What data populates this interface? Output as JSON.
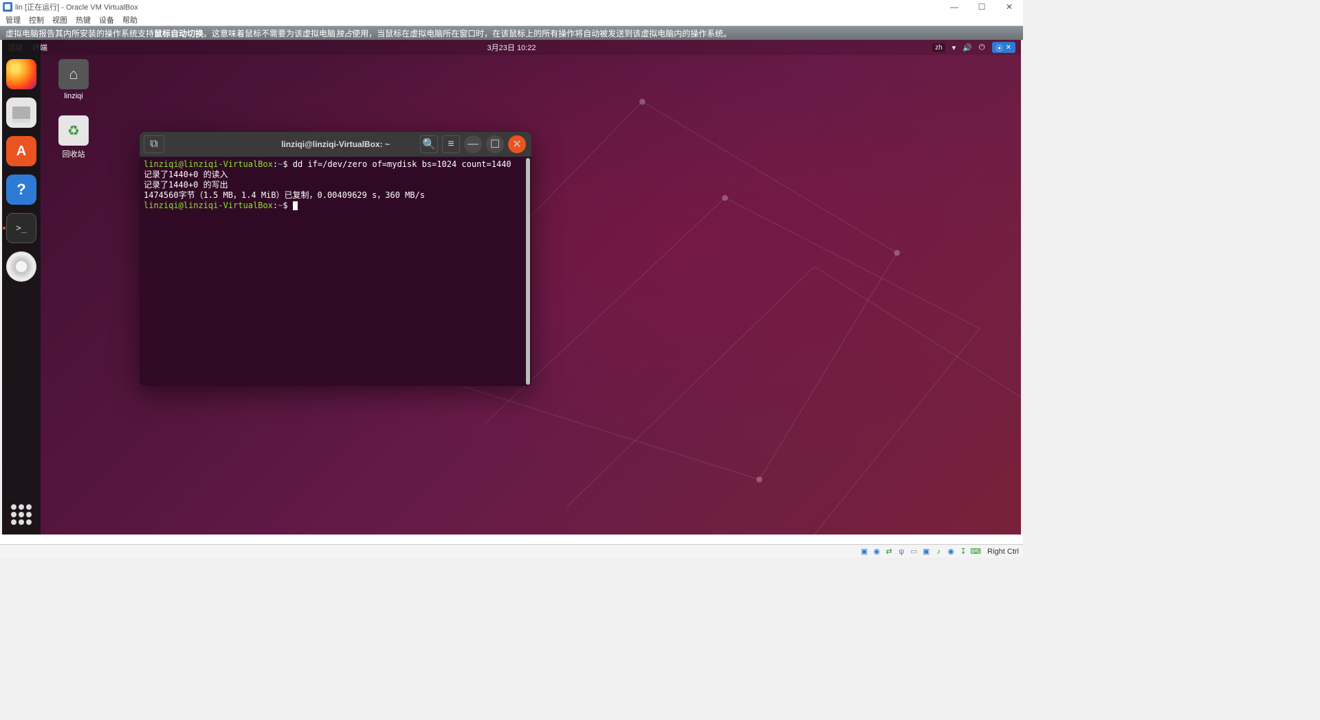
{
  "virtualbox": {
    "title": "lin [正在运行] - Oracle VM VirtualBox",
    "menu": [
      "管理",
      "控制",
      "视图",
      "热键",
      "设备",
      "帮助"
    ],
    "win_buttons": {
      "min": "—",
      "max": "☐",
      "close": "✕"
    },
    "banner": {
      "pre": "虚拟电脑报告其内所安装的操作系统支持 ",
      "bold": "鼠标自动切换",
      "mid": "。这意味着鼠标不需要为该虚拟电脑 ",
      "italic": "独占",
      "post": " 使用，当鼠标在虚拟电脑所在窗口时，在该鼠标上的所有操作将自动被发送到该虚拟电脑内的操作系统。"
    },
    "status": {
      "hostkey": "Right Ctrl"
    }
  },
  "gnome": {
    "activities": "活动",
    "app_label": "终端",
    "clock": "3月23日 10:22",
    "lang": "zh",
    "a11y_glyph": "⦿",
    "a11y_cross": "✕"
  },
  "desktop": {
    "home_label": "linziqi",
    "trash_label": "回收站"
  },
  "terminal": {
    "title": "linziqi@linziqi-VirtualBox: ~",
    "newtab_glyph": "⧉",
    "search_glyph": "🔍",
    "menu_glyph": "≡",
    "min_glyph": "—",
    "max_glyph": "☐",
    "close_glyph": "✕",
    "prompt_user": "linziqi@linziqi-VirtualBox",
    "prompt_path": "~",
    "prompt_sep": ":",
    "prompt_dollar": "$ ",
    "lines": [
      {
        "cmd": "dd if=/dev/zero of=mydisk bs=1024 count=1440"
      },
      {
        "out": "记录了1440+0 的读入"
      },
      {
        "out": "记录了1440+0 的写出"
      },
      {
        "out": "1474560字节（1.5 MB，1.4 MiB）已复制，0.00409629 s，360 MB/s"
      }
    ]
  }
}
